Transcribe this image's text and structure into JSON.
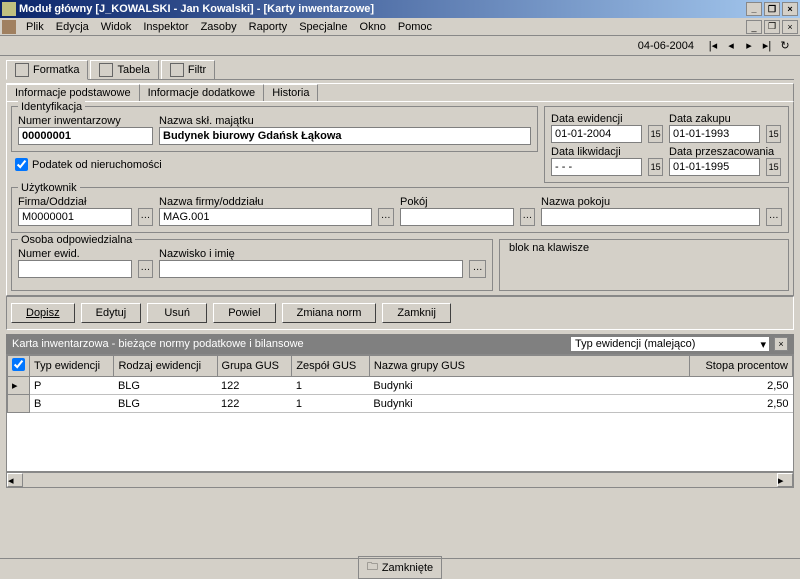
{
  "window": {
    "title": "Moduł główny [J_KOWALSKI - Jan Kowalski] - [Karty inwentarzowe]"
  },
  "menu": [
    "Plik",
    "Edycja",
    "Widok",
    "Inspektor",
    "Zasoby",
    "Raporty",
    "Specjalne",
    "Okno",
    "Pomoc"
  ],
  "toolbar_date": "04-06-2004",
  "top_tabs": {
    "formatka": "Formatka",
    "tabela": "Tabela",
    "filtr": "Filtr"
  },
  "sub_tabs": {
    "podst": "Informacje  podstawowe",
    "dodatk": "Informacje dodatkowe",
    "hist": "Historia"
  },
  "ident": {
    "legend": "Identyfikacja",
    "num_label": "Numer inwentarzowy",
    "num": "00000001",
    "nazwa_label": "Nazwa skł. majątku",
    "nazwa": "Budynek biurowy Gdańsk Łąkowa"
  },
  "dates": {
    "ewid_label": "Data ewidencji",
    "ewid": "01-01-2004",
    "zakupu_label": "Data zakupu",
    "zakupu": "01-01-1993",
    "likw_label": "Data likwidacji",
    "likw": "- - -",
    "przes_label": "Data przeszacowania",
    "przes": "01-01-1995"
  },
  "podatek": "Podatek od nieruchomości",
  "uzyt": {
    "legend": "Użytkownik",
    "firma_label": "Firma/Oddział",
    "firma": "M0000001",
    "nazwa_firmy_label": "Nazwa firmy/oddziału",
    "nazwa_firmy": "MAG.001",
    "pokoj_label": "Pokój",
    "pokoj": "",
    "nazwa_pokoju_label": "Nazwa pokoju",
    "nazwa_pokoju": ""
  },
  "osoba": {
    "legend": "Osoba odpowiedzialna",
    "num_label": "Numer ewid.",
    "num": "",
    "nazw_label": "Nazwisko i imię",
    "nazw": ""
  },
  "blok": "blok na klawisze",
  "buttons": {
    "dopisz": "Dopisz",
    "edytuj": "Edytuj",
    "usun": "Usuń",
    "powiel": "Powiel",
    "zmiana": "Zmiana norm",
    "zamknij": "Zamknij"
  },
  "grid": {
    "title": "Karta inwentarzowa - bieżące normy podatkowe i bilansowe",
    "sort": "Typ ewidencji (malejąco)",
    "headers": [
      "Typ ewidencji",
      "Rodzaj ewidencji",
      "Grupa GUS",
      "Zespół GUS",
      "Nazwa grupy GUS",
      "Stopa procentow"
    ],
    "rows": [
      {
        "typ": "P",
        "rodzaj": "BLG",
        "grupa": "122",
        "zespol": "1",
        "nazwa": "Budynki",
        "stopa": "2,50"
      },
      {
        "typ": "B",
        "rodzaj": "BLG",
        "grupa": "122",
        "zespol": "1",
        "nazwa": "Budynki",
        "stopa": "2,50"
      }
    ]
  },
  "status": "Zamknięte"
}
